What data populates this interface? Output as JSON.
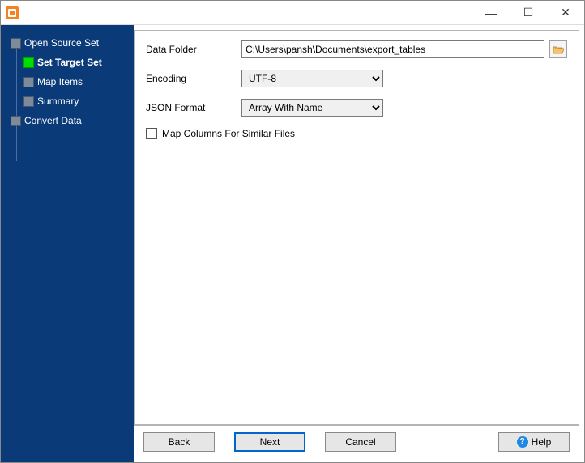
{
  "titlebar": {
    "title": "",
    "min_glyph": "—",
    "max_glyph": "☐",
    "close_glyph": "✕"
  },
  "sidebar": {
    "items": [
      {
        "label": "Open Source Set",
        "child": false,
        "active": false,
        "current": false
      },
      {
        "label": "Set Target Set",
        "child": true,
        "active": true,
        "current": true
      },
      {
        "label": "Map Items",
        "child": true,
        "active": false,
        "current": false
      },
      {
        "label": "Summary",
        "child": true,
        "active": false,
        "current": false
      },
      {
        "label": "Convert Data",
        "child": false,
        "active": false,
        "current": false
      }
    ]
  },
  "form": {
    "data_folder_label": "Data Folder",
    "data_folder_value": "C:\\Users\\pansh\\Documents\\export_tables",
    "encoding_label": "Encoding",
    "encoding_value": "UTF-8",
    "json_format_label": "JSON Format",
    "json_format_value": "Array With Name",
    "map_columns_label": "Map Columns For Similar Files",
    "map_columns_checked": false
  },
  "buttons": {
    "back": "Back",
    "next": "Next",
    "cancel": "Cancel",
    "help": "Help"
  }
}
